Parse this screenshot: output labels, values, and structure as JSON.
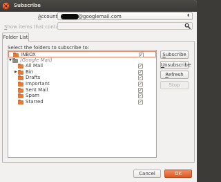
{
  "window": {
    "title": "Subscribe",
    "close_glyph": "×",
    "accent_color": "#e25a23"
  },
  "account": {
    "label_prefix": "A",
    "label_rest": "ccount:",
    "email_suffix": "@googlemail.com",
    "arrow": "⬍"
  },
  "filter": {
    "label_prefix": "S",
    "label_rest": "how items that contain:",
    "value": "",
    "icon": "search-icon"
  },
  "tabs": [
    {
      "label": "Folder List"
    }
  ],
  "folder_list": {
    "header": "Select the folders to subscribe to:",
    "rows": [
      {
        "label": "INBOX",
        "checked": true,
        "indent": 0,
        "expander": "",
        "icon": "folder-icon",
        "selected": true,
        "italic": false
      },
      {
        "label": "[Google Mail]",
        "checked": false,
        "indent": 0,
        "expander": "▼",
        "icon": "folder-icon-gray",
        "selected": false,
        "italic": true
      },
      {
        "label": "All Mail",
        "checked": true,
        "indent": 1,
        "expander": "",
        "icon": "folder-icon",
        "selected": false,
        "italic": false
      },
      {
        "label": "Bin",
        "checked": true,
        "indent": 1,
        "expander": "▶",
        "icon": "folder-icon",
        "selected": false,
        "italic": false
      },
      {
        "label": "Drafts",
        "checked": true,
        "indent": 1,
        "expander": "",
        "icon": "folder-icon",
        "selected": false,
        "italic": false
      },
      {
        "label": "Important",
        "checked": true,
        "indent": 1,
        "expander": "",
        "icon": "folder-icon",
        "selected": false,
        "italic": false
      },
      {
        "label": "Sent Mail",
        "checked": true,
        "indent": 1,
        "expander": "",
        "icon": "folder-icon",
        "selected": false,
        "italic": false
      },
      {
        "label": "Spam",
        "checked": true,
        "indent": 1,
        "expander": "",
        "icon": "folder-icon",
        "selected": false,
        "italic": false
      },
      {
        "label": "Starred",
        "checked": true,
        "indent": 1,
        "expander": "",
        "icon": "folder-icon",
        "selected": false,
        "italic": false
      }
    ],
    "check_glyph": "✓"
  },
  "actions": {
    "subscribe_prefix": "S",
    "subscribe_rest": "ubscribe",
    "unsubscribe_prefix": "U",
    "unsubscribe_rest": "nsubscribe",
    "refresh_prefix": "R",
    "refresh_rest": "efresh",
    "stop": "Stop",
    "stop_enabled": false
  },
  "footer": {
    "cancel": "Cancel",
    "ok": "OK"
  }
}
